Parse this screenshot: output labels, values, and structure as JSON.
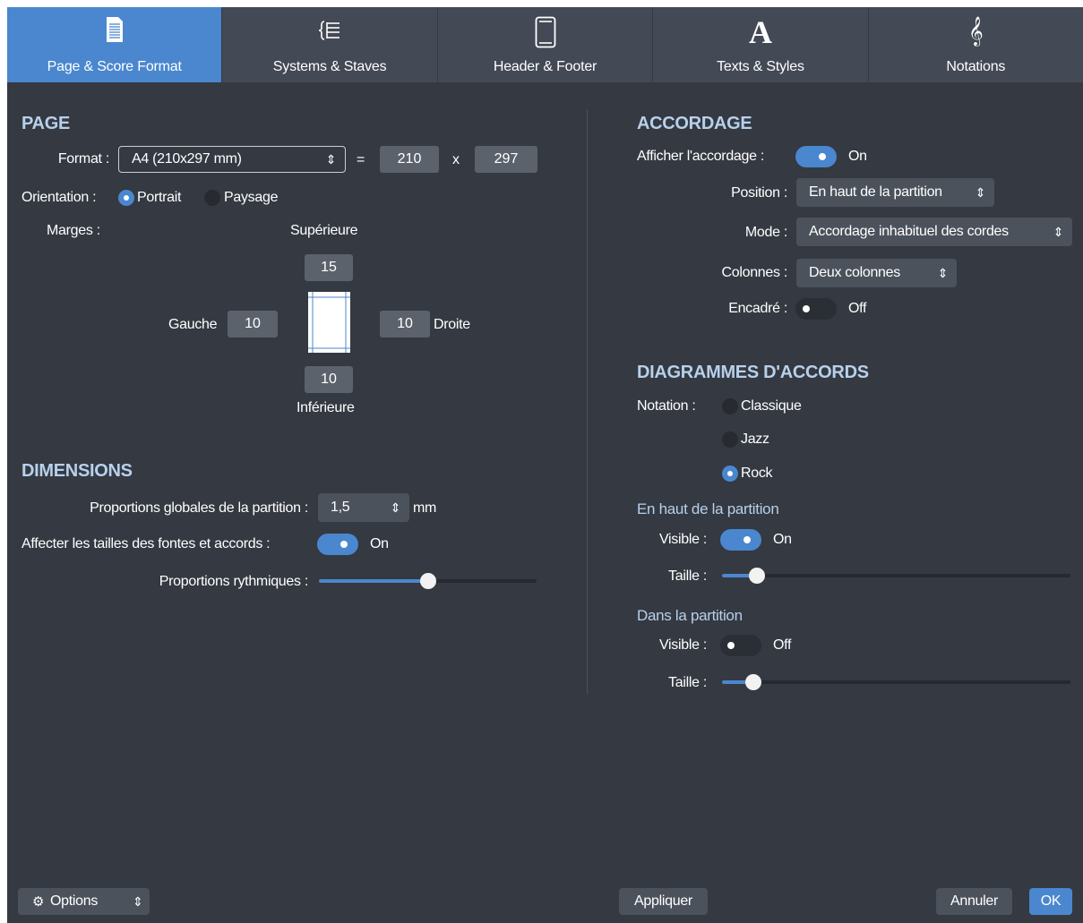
{
  "tabs": [
    {
      "label": "Page & Score Format",
      "icon": "page-icon",
      "active": true
    },
    {
      "label": "Systems & Staves",
      "icon": "systems-icon",
      "active": false
    },
    {
      "label": "Header & Footer",
      "icon": "header-footer-icon",
      "active": false
    },
    {
      "label": "Texts & Styles",
      "icon": "text-style-icon",
      "active": false
    },
    {
      "label": "Notations",
      "icon": "treble-clef-icon",
      "active": false
    }
  ],
  "page": {
    "title": "PAGE",
    "format_label": "Format :",
    "format_value": "A4 (210x297 mm)",
    "equals": "=",
    "width": "210",
    "times": "x",
    "height": "297",
    "orientation_label": "Orientation :",
    "portrait": "Portrait",
    "landscape": "Paysage",
    "orientation_selected": "Portrait",
    "margins_label": "Marges :",
    "top_label": "Supérieure",
    "top_value": "15",
    "left_label": "Gauche",
    "left_value": "10",
    "right_value": "10",
    "right_label": "Droite",
    "bottom_value": "10",
    "bottom_label": "Inférieure"
  },
  "dimensions": {
    "title": "DIMENSIONS",
    "scale_label": "Proportions globales de la partition :",
    "scale_value": "1,5",
    "scale_unit": "mm",
    "affect_label": "Affecter les tailles des fontes et accords :",
    "affect_state": "On",
    "rhythm_label": "Proportions rythmiques :",
    "rhythm_level": 0.5
  },
  "accordage": {
    "title": "ACCORDAGE",
    "show_label": "Afficher l'accordage :",
    "show_state": "On",
    "position_label": "Position :",
    "position_value": "En haut de la partition",
    "mode_label": "Mode :",
    "mode_value": "Accordage inhabituel des cordes",
    "columns_label": "Colonnes :",
    "columns_value": "Deux colonnes",
    "frame_label": "Encadré :",
    "frame_state": "Off"
  },
  "chords": {
    "title": "DIAGRAMMES D'ACCORDS",
    "notation_label": "Notation :",
    "options": [
      "Classique",
      "Jazz",
      "Rock"
    ],
    "selected": "Rock",
    "top_title": "En haut de la partition",
    "top_visible_label": "Visible :",
    "top_visible_state": "On",
    "top_size_label": "Taille :",
    "top_size_level": 0.1,
    "in_title": "Dans la partition",
    "in_visible_label": "Visible :",
    "in_visible_state": "Off",
    "in_size_label": "Taille :",
    "in_size_level": 0.09
  },
  "footer": {
    "options": "Options",
    "apply": "Appliquer",
    "cancel": "Annuler",
    "ok": "OK"
  },
  "colors": {
    "accent": "#4a87cf",
    "panel": "#343942",
    "section_title": "#b8d0ea"
  }
}
